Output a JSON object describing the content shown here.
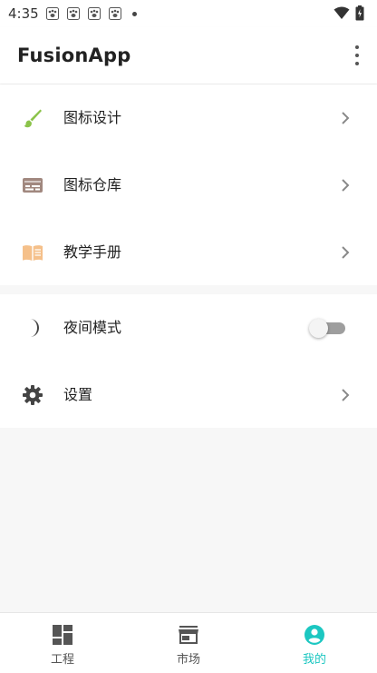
{
  "statusbar": {
    "time": "4:35",
    "notification_icons": [
      "paw-icon",
      "paw-icon",
      "paw-icon",
      "paw-icon"
    ]
  },
  "appbar": {
    "title": "FusionApp",
    "menu_icon": "more-vert-icon"
  },
  "menu": {
    "items": [
      {
        "label": "图标设计",
        "icon": "brush-icon",
        "icon_color": "#8bc34a"
      },
      {
        "label": "图标仓库",
        "icon": "card-icon",
        "icon_color": "#a1887f"
      },
      {
        "label": "教学手册",
        "icon": "book-icon",
        "icon_color": "#f5c08a"
      }
    ]
  },
  "settings": {
    "items": [
      {
        "label": "夜间模式",
        "icon": "moon-icon",
        "toggle_on": false
      },
      {
        "label": "设置",
        "icon": "gear-icon"
      }
    ]
  },
  "bottom_nav": {
    "items": [
      {
        "label": "工程",
        "icon": "dashboard-icon",
        "active": false
      },
      {
        "label": "市场",
        "icon": "store-icon",
        "active": false
      },
      {
        "label": "我的",
        "icon": "account-icon",
        "active": true
      }
    ],
    "active_color": "#1cc7c1"
  }
}
